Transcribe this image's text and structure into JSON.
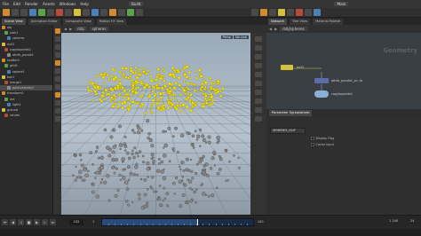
{
  "menubar": {
    "items": [
      "File",
      "Edit",
      "Render",
      "Assets",
      "Windows",
      "Help"
    ],
    "desktop": "Build",
    "right_label": "Main"
  },
  "tabs_left": [
    "Scene View",
    "Animation Editor",
    "Composite View",
    "Motion FX View"
  ],
  "tabs_right": [
    "Network",
    "Tree View",
    "Material Palette"
  ],
  "viewport": {
    "tab": "Scene View",
    "path": "/obj",
    "subpath": "spheres",
    "view_label": "Persp",
    "camera_label": "No cam"
  },
  "network": {
    "path": "/obj/spheres",
    "watermark": "Geometry",
    "node_top_label": "null2",
    "node_mid_label": "attrib_pscale1_pr...ts",
    "node_bot_label": "copytopoints1",
    "node_top_color": "#d6c23a",
    "node_mid_color": "#5b6ea8",
    "node_bot_color": "#8ab0d8"
  },
  "parms": {
    "tabs": [
      "Parameter Spreadsheet"
    ],
    "node_name": "SPHERES_OUT",
    "rows": [
      "Display Flag",
      "Cache Input"
    ]
  },
  "tree": {
    "rows": [
      "obj",
      "cam1",
      "spheres",
      "null2",
      "copytopoints1",
      "attrib_pscale1",
      "scatter1",
      "grid1",
      "sphere1",
      "box1",
      "merge1",
      "pointvelocity1",
      "transform1",
      "out",
      "light1",
      "ground",
      "render"
    ],
    "selected_index": 11
  },
  "timeline": {
    "current_frame": "152",
    "start_frame": "1",
    "end_frame": "240",
    "range_readout": "1 240",
    "progress": 0.63,
    "fps_label": "24"
  },
  "colors": {
    "points": "#f3e200",
    "spheres": "#888888",
    "grid": "#5f6b75",
    "accent": "#d48a2c"
  }
}
